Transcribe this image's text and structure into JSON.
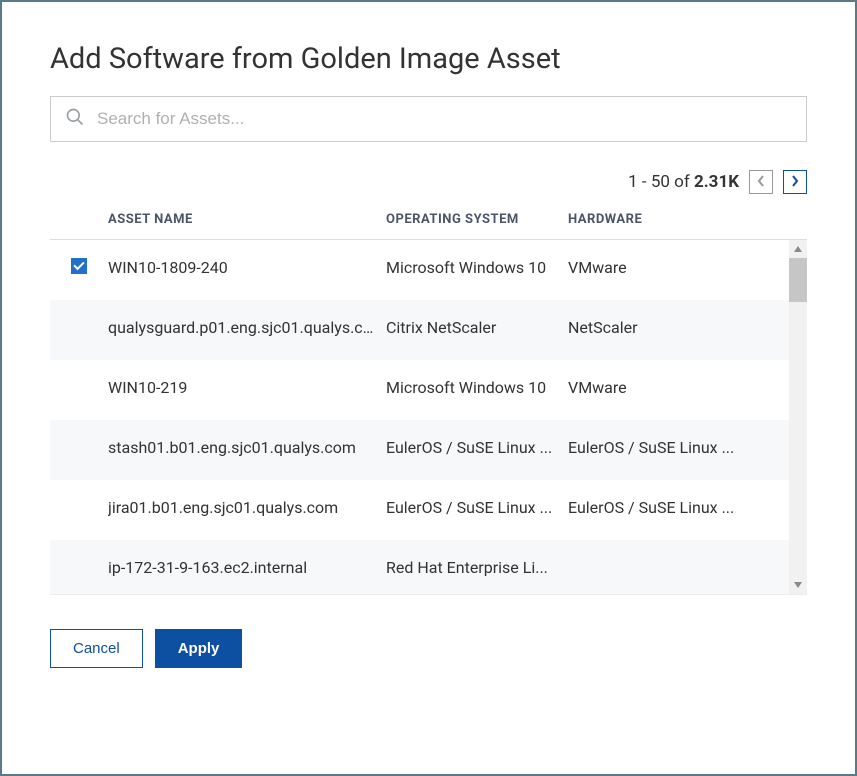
{
  "dialog": {
    "title": "Add Software from Golden Image Asset"
  },
  "search": {
    "placeholder": "Search for Assets..."
  },
  "pagination": {
    "range_prefix": "1 - 50 of",
    "total": "2.31K"
  },
  "columns": {
    "asset_name": "ASSET NAME",
    "os": "OPERATING SYSTEM",
    "hardware": "HARDWARE"
  },
  "rows": [
    {
      "checked": true,
      "asset": "WIN10-1809-240",
      "os": "Microsoft Windows 10",
      "hardware": "VMware"
    },
    {
      "checked": false,
      "asset": "qualysguard.p01.eng.sjc01.qualys.c...",
      "os": "Citrix NetScaler",
      "hardware": "NetScaler"
    },
    {
      "checked": false,
      "asset": "WIN10-219",
      "os": "Microsoft Windows 10",
      "hardware": "VMware"
    },
    {
      "checked": false,
      "asset": "stash01.b01.eng.sjc01.qualys.com",
      "os": "EulerOS / SuSE Linux ...",
      "hardware": "EulerOS / SuSE Linux ..."
    },
    {
      "checked": false,
      "asset": "jira01.b01.eng.sjc01.qualys.com",
      "os": "EulerOS / SuSE Linux ...",
      "hardware": "EulerOS / SuSE Linux ..."
    },
    {
      "checked": false,
      "asset": "ip-172-31-9-163.ec2.internal",
      "os": "Red Hat Enterprise Li...",
      "hardware": ""
    }
  ],
  "buttons": {
    "cancel": "Cancel",
    "apply": "Apply"
  }
}
